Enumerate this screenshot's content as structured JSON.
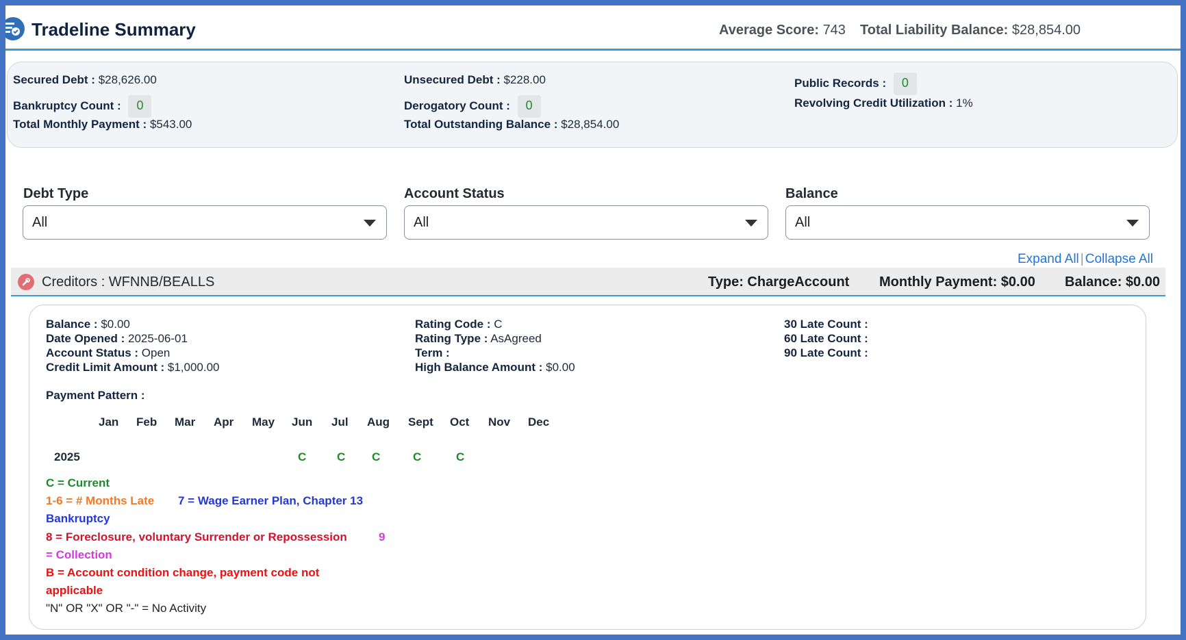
{
  "header": {
    "title": "Tradeline Summary",
    "average_score_label": "Average Score:",
    "average_score": "743",
    "total_liability_label": "Total Liability Balance:",
    "total_liability": "$28,854.00"
  },
  "summary": {
    "secured_debt_label": "Secured Debt :",
    "secured_debt": "$28,626.00",
    "bankruptcy_count_label": "Bankruptcy Count :",
    "bankruptcy_count": "0",
    "total_monthly_payment_label": "Total Monthly Payment :",
    "total_monthly_payment": "$543.00",
    "unsecured_debt_label": "Unsecured Debt :",
    "unsecured_debt": "$228.00",
    "derogatory_count_label": "Derogatory Count :",
    "derogatory_count": "0",
    "total_outstanding_label": "Total Outstanding Balance :",
    "total_outstanding": "$28,854.00",
    "public_records_label": "Public Records :",
    "public_records": "0",
    "revolving_label": "Revolving Credit Utilization :",
    "revolving": "1%"
  },
  "filters": {
    "debt_type_label": "Debt Type",
    "debt_type_value": "All",
    "account_status_label": "Account Status",
    "account_status_value": "All",
    "balance_label": "Balance",
    "balance_value": "All"
  },
  "links": {
    "expand_all": "Expand All",
    "separator": "|",
    "collapse_all": "Collapse All"
  },
  "creditor": {
    "name": "Creditors : WFNNB/BEALLS",
    "type": "Type: ChargeAccount",
    "monthly_payment": "Monthly Payment: $0.00",
    "balance": "Balance: $0.00"
  },
  "details": {
    "balance_label": "Balance :",
    "balance": "$0.00",
    "date_opened_label": "Date Opened :",
    "date_opened": "2025-06-01",
    "account_status_label": "Account Status :",
    "account_status": "Open",
    "credit_limit_label": "Credit Limit Amount :",
    "credit_limit": "$1,000.00",
    "rating_code_label": "Rating Code :",
    "rating_code": "C",
    "rating_type_label": "Rating Type :",
    "rating_type": "AsAgreed",
    "term_label": "Term :",
    "term": "",
    "high_balance_label": "High Balance Amount :",
    "high_balance": "$0.00",
    "late30_label": "30 Late Count :",
    "late60_label": "60 Late Count :",
    "late90_label": "90 Late Count :"
  },
  "payment_pattern": {
    "label": "Payment Pattern :",
    "months": [
      "Jan",
      "Feb",
      "Mar",
      "Apr",
      "May",
      "Jun",
      "Jul",
      "Aug",
      "Sept",
      "Oct",
      "Nov",
      "Dec"
    ],
    "year": "2025",
    "codes": [
      "",
      "",
      "",
      "",
      "",
      "C",
      "C",
      "C",
      "C",
      "C",
      "",
      ""
    ]
  },
  "legend": {
    "current": "C = Current",
    "months_late": "1-6 = # Months Late",
    "wage_earner_1": "7 = Wage Earner Plan, Chapter 13",
    "wage_earner_2": "Bankruptcy",
    "foreclosure": "8 = Foreclosure, voluntary Surrender or Repossession",
    "collection_1": "9",
    "collection_2": "= Collection",
    "condition_change_1": "B = Account condition change, payment code not",
    "condition_change_2": "applicable",
    "no_activity": "\"N\" OR \"X\" OR \"-\" = No Activity"
  },
  "colors": {
    "accent": "#3b9ad9",
    "frame": "#4472c4",
    "link": "#2274d6",
    "current_green": "#1f8a2a"
  }
}
